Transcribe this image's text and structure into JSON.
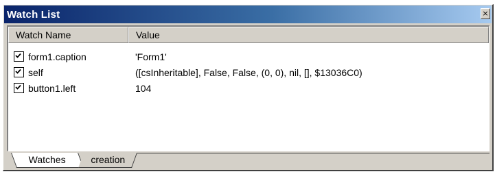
{
  "window": {
    "title": "Watch List",
    "close_glyph": "×"
  },
  "columns": {
    "name": "Watch Name",
    "value": "Value"
  },
  "watches": [
    {
      "name": "form1.caption",
      "value": "'Form1'",
      "checked": true
    },
    {
      "name": "self",
      "value": "([csInheritable], False, False, (0, 0), nil, [], $13036C0)",
      "checked": true
    },
    {
      "name": "button1.left",
      "value": "104",
      "checked": true
    }
  ],
  "tabs": [
    {
      "label": "Watches",
      "active": true
    },
    {
      "label": "creation",
      "active": false
    }
  ],
  "colors": {
    "title_start": "#0a246a",
    "title_end": "#a6caf0",
    "face": "#d4d0c8"
  }
}
